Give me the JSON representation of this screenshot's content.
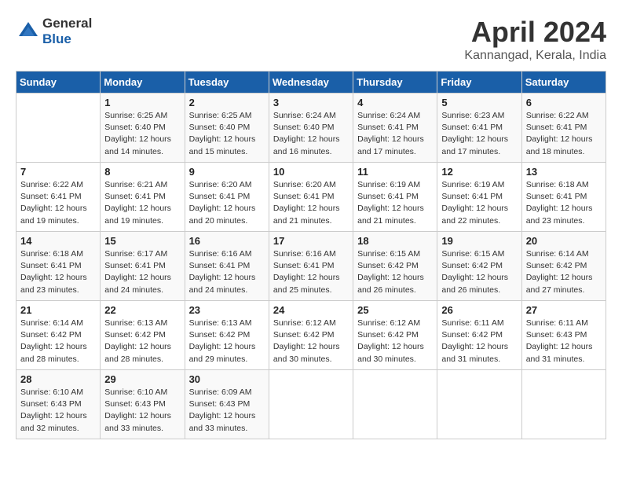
{
  "logo": {
    "general": "General",
    "blue": "Blue"
  },
  "title": "April 2024",
  "location": "Kannangad, Kerala, India",
  "days_of_week": [
    "Sunday",
    "Monday",
    "Tuesday",
    "Wednesday",
    "Thursday",
    "Friday",
    "Saturday"
  ],
  "weeks": [
    [
      {
        "day": "",
        "info": ""
      },
      {
        "day": "1",
        "info": "Sunrise: 6:25 AM\nSunset: 6:40 PM\nDaylight: 12 hours\nand 14 minutes."
      },
      {
        "day": "2",
        "info": "Sunrise: 6:25 AM\nSunset: 6:40 PM\nDaylight: 12 hours\nand 15 minutes."
      },
      {
        "day": "3",
        "info": "Sunrise: 6:24 AM\nSunset: 6:40 PM\nDaylight: 12 hours\nand 16 minutes."
      },
      {
        "day": "4",
        "info": "Sunrise: 6:24 AM\nSunset: 6:41 PM\nDaylight: 12 hours\nand 17 minutes."
      },
      {
        "day": "5",
        "info": "Sunrise: 6:23 AM\nSunset: 6:41 PM\nDaylight: 12 hours\nand 17 minutes."
      },
      {
        "day": "6",
        "info": "Sunrise: 6:22 AM\nSunset: 6:41 PM\nDaylight: 12 hours\nand 18 minutes."
      }
    ],
    [
      {
        "day": "7",
        "info": "Sunrise: 6:22 AM\nSunset: 6:41 PM\nDaylight: 12 hours\nand 19 minutes."
      },
      {
        "day": "8",
        "info": "Sunrise: 6:21 AM\nSunset: 6:41 PM\nDaylight: 12 hours\nand 19 minutes."
      },
      {
        "day": "9",
        "info": "Sunrise: 6:20 AM\nSunset: 6:41 PM\nDaylight: 12 hours\nand 20 minutes."
      },
      {
        "day": "10",
        "info": "Sunrise: 6:20 AM\nSunset: 6:41 PM\nDaylight: 12 hours\nand 21 minutes."
      },
      {
        "day": "11",
        "info": "Sunrise: 6:19 AM\nSunset: 6:41 PM\nDaylight: 12 hours\nand 21 minutes."
      },
      {
        "day": "12",
        "info": "Sunrise: 6:19 AM\nSunset: 6:41 PM\nDaylight: 12 hours\nand 22 minutes."
      },
      {
        "day": "13",
        "info": "Sunrise: 6:18 AM\nSunset: 6:41 PM\nDaylight: 12 hours\nand 23 minutes."
      }
    ],
    [
      {
        "day": "14",
        "info": "Sunrise: 6:18 AM\nSunset: 6:41 PM\nDaylight: 12 hours\nand 23 minutes."
      },
      {
        "day": "15",
        "info": "Sunrise: 6:17 AM\nSunset: 6:41 PM\nDaylight: 12 hours\nand 24 minutes."
      },
      {
        "day": "16",
        "info": "Sunrise: 6:16 AM\nSunset: 6:41 PM\nDaylight: 12 hours\nand 24 minutes."
      },
      {
        "day": "17",
        "info": "Sunrise: 6:16 AM\nSunset: 6:41 PM\nDaylight: 12 hours\nand 25 minutes."
      },
      {
        "day": "18",
        "info": "Sunrise: 6:15 AM\nSunset: 6:42 PM\nDaylight: 12 hours\nand 26 minutes."
      },
      {
        "day": "19",
        "info": "Sunrise: 6:15 AM\nSunset: 6:42 PM\nDaylight: 12 hours\nand 26 minutes."
      },
      {
        "day": "20",
        "info": "Sunrise: 6:14 AM\nSunset: 6:42 PM\nDaylight: 12 hours\nand 27 minutes."
      }
    ],
    [
      {
        "day": "21",
        "info": "Sunrise: 6:14 AM\nSunset: 6:42 PM\nDaylight: 12 hours\nand 28 minutes."
      },
      {
        "day": "22",
        "info": "Sunrise: 6:13 AM\nSunset: 6:42 PM\nDaylight: 12 hours\nand 28 minutes."
      },
      {
        "day": "23",
        "info": "Sunrise: 6:13 AM\nSunset: 6:42 PM\nDaylight: 12 hours\nand 29 minutes."
      },
      {
        "day": "24",
        "info": "Sunrise: 6:12 AM\nSunset: 6:42 PM\nDaylight: 12 hours\nand 30 minutes."
      },
      {
        "day": "25",
        "info": "Sunrise: 6:12 AM\nSunset: 6:42 PM\nDaylight: 12 hours\nand 30 minutes."
      },
      {
        "day": "26",
        "info": "Sunrise: 6:11 AM\nSunset: 6:42 PM\nDaylight: 12 hours\nand 31 minutes."
      },
      {
        "day": "27",
        "info": "Sunrise: 6:11 AM\nSunset: 6:43 PM\nDaylight: 12 hours\nand 31 minutes."
      }
    ],
    [
      {
        "day": "28",
        "info": "Sunrise: 6:10 AM\nSunset: 6:43 PM\nDaylight: 12 hours\nand 32 minutes."
      },
      {
        "day": "29",
        "info": "Sunrise: 6:10 AM\nSunset: 6:43 PM\nDaylight: 12 hours\nand 33 minutes."
      },
      {
        "day": "30",
        "info": "Sunrise: 6:09 AM\nSunset: 6:43 PM\nDaylight: 12 hours\nand 33 minutes."
      },
      {
        "day": "",
        "info": ""
      },
      {
        "day": "",
        "info": ""
      },
      {
        "day": "",
        "info": ""
      },
      {
        "day": "",
        "info": ""
      }
    ]
  ]
}
